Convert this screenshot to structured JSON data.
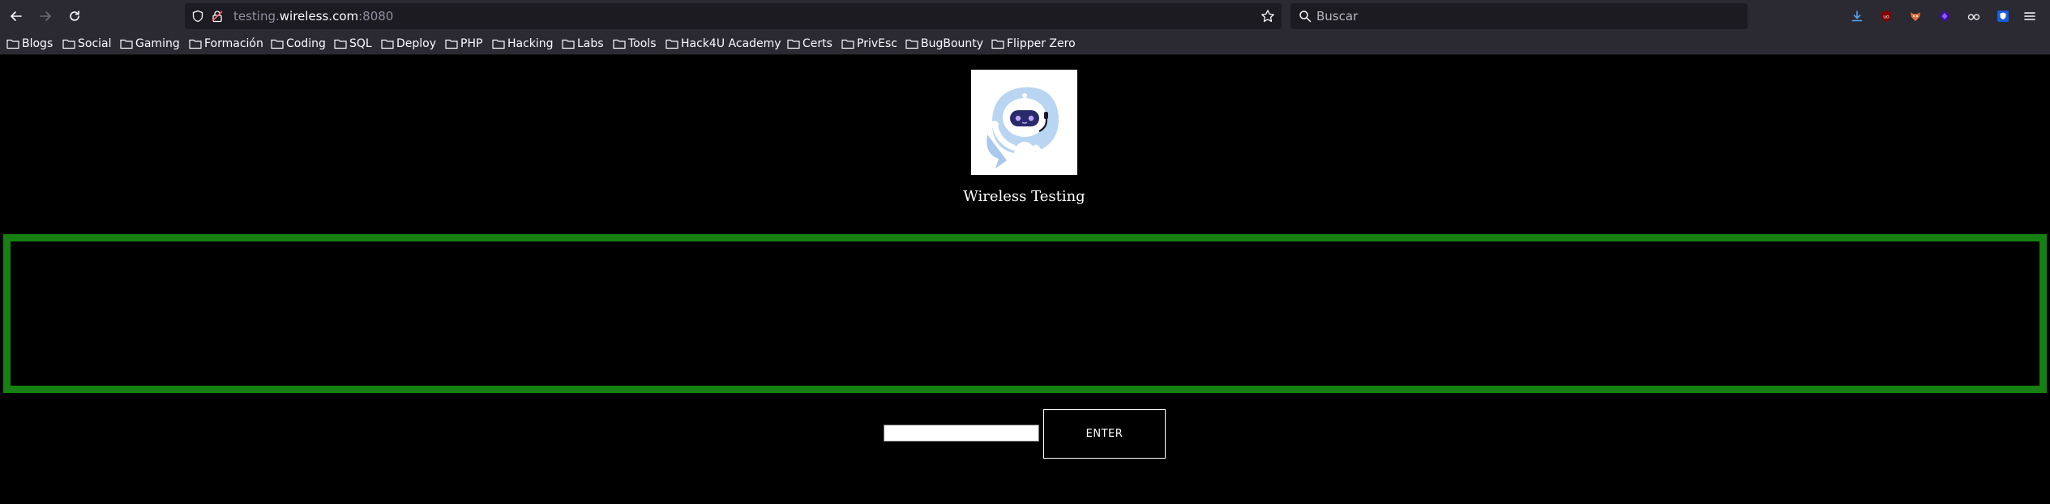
{
  "browser": {
    "url": {
      "scheme_host_prefix": "testing.",
      "host": "wireless.com",
      "port": ":8080"
    },
    "search_placeholder": "Buscar",
    "bookmarks": [
      "Blogs",
      "Social",
      "Gaming",
      "Formación",
      "Coding",
      "SQL",
      "Deploy",
      "PHP",
      "Hacking",
      "Labs",
      "Tools",
      "Hack4U Academy",
      "Certs",
      "PrivEsc",
      "BugBounty",
      "Flipper Zero"
    ],
    "icons": {
      "back": "back-arrow-icon",
      "forward": "forward-arrow-icon",
      "reload": "reload-icon",
      "shield": "tracking-protection-shield-icon",
      "lock": "insecure-lock-icon",
      "bookmark_star": "bookmark-star-icon",
      "search": "search-icon",
      "downloads": "download-icon",
      "menu": "hamburger-menu-icon",
      "folder": "folder-icon"
    }
  },
  "page": {
    "title": "Wireless Testing",
    "output": "",
    "input_value": "",
    "enter_label": "ENTER"
  },
  "colors": {
    "chrome_bg": "#2b2a33",
    "field_bg": "#1c1b22",
    "page_bg": "#000000",
    "output_border": "#168012"
  }
}
